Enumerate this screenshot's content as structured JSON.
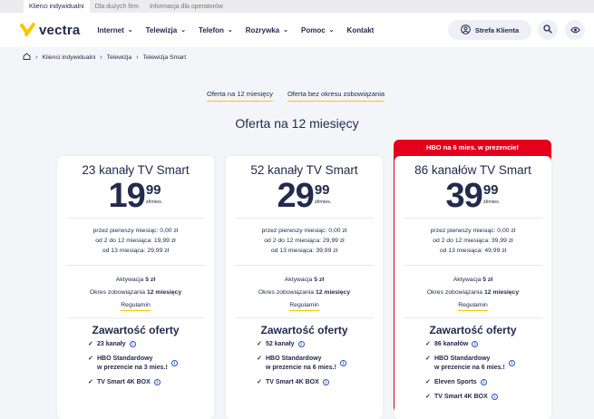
{
  "topbar": {
    "tabs": [
      "Klienci indywidualni",
      "Dla dużych firm",
      "Informacja dla operatorów"
    ]
  },
  "logo": {
    "text": "vectra"
  },
  "nav": [
    {
      "label": "Internet",
      "has_dropdown": true
    },
    {
      "label": "Telewizja",
      "has_dropdown": true
    },
    {
      "label": "Telefon",
      "has_dropdown": true
    },
    {
      "label": "Rozrywka",
      "has_dropdown": true
    },
    {
      "label": "Pomoc",
      "has_dropdown": true
    },
    {
      "label": "Kontakt",
      "has_dropdown": false
    }
  ],
  "strefa_label": "Strefa Klienta",
  "icons": {
    "search": "search-icon",
    "eye": "eye-icon",
    "home": "home-icon",
    "user": "user-icon"
  },
  "breadcrumb": [
    "Klienci indywidualni",
    "Telewizja",
    "Telewizja Smart"
  ],
  "offer_tabs": [
    "Oferta na 12 miesięcy",
    "Oferta bez okresu zobowiązania"
  ],
  "section_title": "Oferta na 12 miesięcy",
  "colors": {
    "brand_navy": "#232a4d",
    "accent_yellow": "#f6c800",
    "promo_red": "#e5001e",
    "info_blue": "#2a52be"
  },
  "plans": [
    {
      "title": "23 kanały TV Smart",
      "price_int": "19",
      "price_dec": "99",
      "price_unit": "zł/mies.",
      "terms": [
        "przez pierwszy miesiąc: 0,00 zł",
        "od 2 do 12 miesiąca: 19,99 zł",
        "od 13 miesiąca: 29,99 zł"
      ],
      "activation_label": "Aktywacja",
      "activation_value": "5 zł",
      "commitment_label": "Okres zobowiązania",
      "commitment_value": "12 miesięcy",
      "regulamin": "Regulamin",
      "content_title": "Zawartość oferty",
      "features": [
        {
          "line1": "23 kanały",
          "line2": ""
        },
        {
          "line1": "HBO Standardowy",
          "line2": "w prezencie na 3 mies.!"
        },
        {
          "line1": "TV Smart 4K BOX",
          "line2": ""
        }
      ]
    },
    {
      "title": "52 kanały TV Smart",
      "price_int": "29",
      "price_dec": "99",
      "price_unit": "zł/mies.",
      "terms": [
        "przez pierwszy miesiąc: 0,00 zł",
        "od 2 do 12 miesiąca: 29,99 zł",
        "od 13 miesiąca: 39,99 zł"
      ],
      "activation_label": "Aktywacja",
      "activation_value": "5 zł",
      "commitment_label": "Okres zobowiązania",
      "commitment_value": "12 miesięcy",
      "regulamin": "Regulamin",
      "content_title": "Zawartość oferty",
      "features": [
        {
          "line1": "52 kanały",
          "line2": ""
        },
        {
          "line1": "HBO Standardowy",
          "line2": "w prezencie na 6 mies.!"
        },
        {
          "line1": "TV Smart 4K BOX",
          "line2": ""
        }
      ]
    },
    {
      "promo": "HBO na 6 mies. w prezencie!",
      "title": "86 kanałów TV Smart",
      "price_int": "39",
      "price_dec": "99",
      "price_unit": "zł/mies.",
      "terms": [
        "przez pierwszy miesiąc: 0,00 zł",
        "od 2 do 12 miesiąca: 39,99 zł",
        "od 13 miesiąca: 49,99 zł"
      ],
      "activation_label": "Aktywacja",
      "activation_value": "5 zł",
      "commitment_label": "Okres zobowiązania",
      "commitment_value": "12 miesięcy",
      "regulamin": "Regulamin",
      "content_title": "Zawartość oferty",
      "features": [
        {
          "line1": "86 kanałów",
          "line2": ""
        },
        {
          "line1": "HBO Standardowy",
          "line2": "w prezencie na 6 mies.!"
        },
        {
          "line1": "Eleven Sports",
          "line2": ""
        },
        {
          "line1": "TV Smart 4K BOX",
          "line2": ""
        }
      ]
    }
  ]
}
